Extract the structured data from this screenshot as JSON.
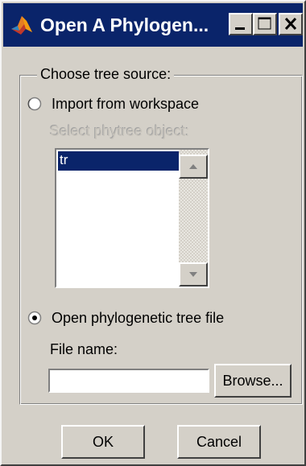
{
  "window": {
    "title": "Open A Phylogen...",
    "controls": {
      "minimize": "minimize",
      "maximize": "maximize",
      "close": "close"
    }
  },
  "group": {
    "label": "Choose tree source:"
  },
  "workspace_option": {
    "label": "Import from workspace",
    "selected": false,
    "select_label": "Select phytree object:",
    "list_items": [
      "tr"
    ],
    "selected_item": "tr"
  },
  "file_option": {
    "label": "Open phylogenetic tree file",
    "selected": true,
    "file_name_label": "File name:",
    "file_name_value": "",
    "browse_label": "Browse..."
  },
  "buttons": {
    "ok_label": "OK",
    "cancel_label": "Cancel"
  },
  "colors": {
    "titlebar": "#0a246a",
    "face": "#d4d0c8",
    "selection": "#0a246a"
  }
}
